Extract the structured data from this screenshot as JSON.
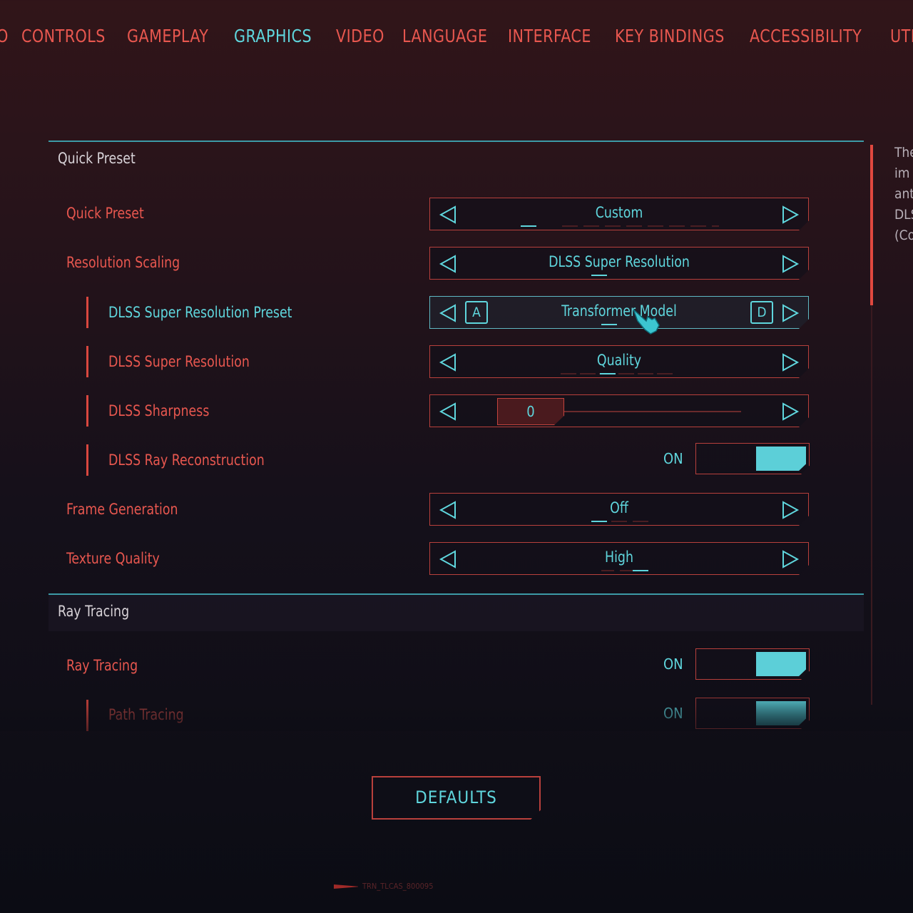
{
  "tabs": [
    {
      "label": "AUDIO",
      "active": false
    },
    {
      "label": "CONTROLS",
      "active": false
    },
    {
      "label": "GAMEPLAY",
      "active": false
    },
    {
      "label": "GRAPHICS",
      "active": true
    },
    {
      "label": "VIDEO",
      "active": false
    },
    {
      "label": "LANGUAGE",
      "active": false
    },
    {
      "label": "INTERFACE",
      "active": false
    },
    {
      "label": "KEY BINDINGS",
      "active": false
    },
    {
      "label": "ACCESSIBILITY",
      "active": false
    },
    {
      "label": "UTILITIES",
      "active": false
    }
  ],
  "colors": {
    "accent_red": "#e8574f",
    "accent_cyan": "#5fd6dd",
    "background": "#311519"
  },
  "sections": {
    "quick_preset": {
      "title": "Quick Preset"
    },
    "ray_tracing": {
      "title": "Ray Tracing"
    }
  },
  "settings": {
    "quick_preset": {
      "label": "Quick Preset",
      "value": "Custom"
    },
    "resolution_scaling": {
      "label": "Resolution Scaling",
      "value": "DLSS Super Resolution"
    },
    "dlss_preset": {
      "label": "DLSS Super Resolution Preset",
      "value": "Transformer Model",
      "key_left": "A",
      "key_right": "D"
    },
    "dlss_sr": {
      "label": "DLSS Super Resolution",
      "value": "Quality"
    },
    "dlss_sharpness": {
      "label": "DLSS Sharpness",
      "value": "0"
    },
    "dlss_rr": {
      "label": "DLSS Ray Reconstruction",
      "state": "ON"
    },
    "frame_gen": {
      "label": "Frame Generation",
      "value": "Off"
    },
    "texture_quality": {
      "label": "Texture Quality",
      "value": "High"
    },
    "ray_tracing": {
      "label": "Ray Tracing",
      "state": "ON"
    },
    "path_tracing": {
      "label": "Path Tracing",
      "state": "ON"
    }
  },
  "icons": {
    "arrow_left": "triangle-left-outline",
    "arrow_right": "triangle-right-outline",
    "cursor": "pointing-hand-cursor"
  },
  "description_fragments": [
    "The",
    "im",
    "ant",
    "DLS",
    "(Co"
  ],
  "defaults_button": "DEFAULTS",
  "footer_code": "TRN_TLCAS_800095"
}
